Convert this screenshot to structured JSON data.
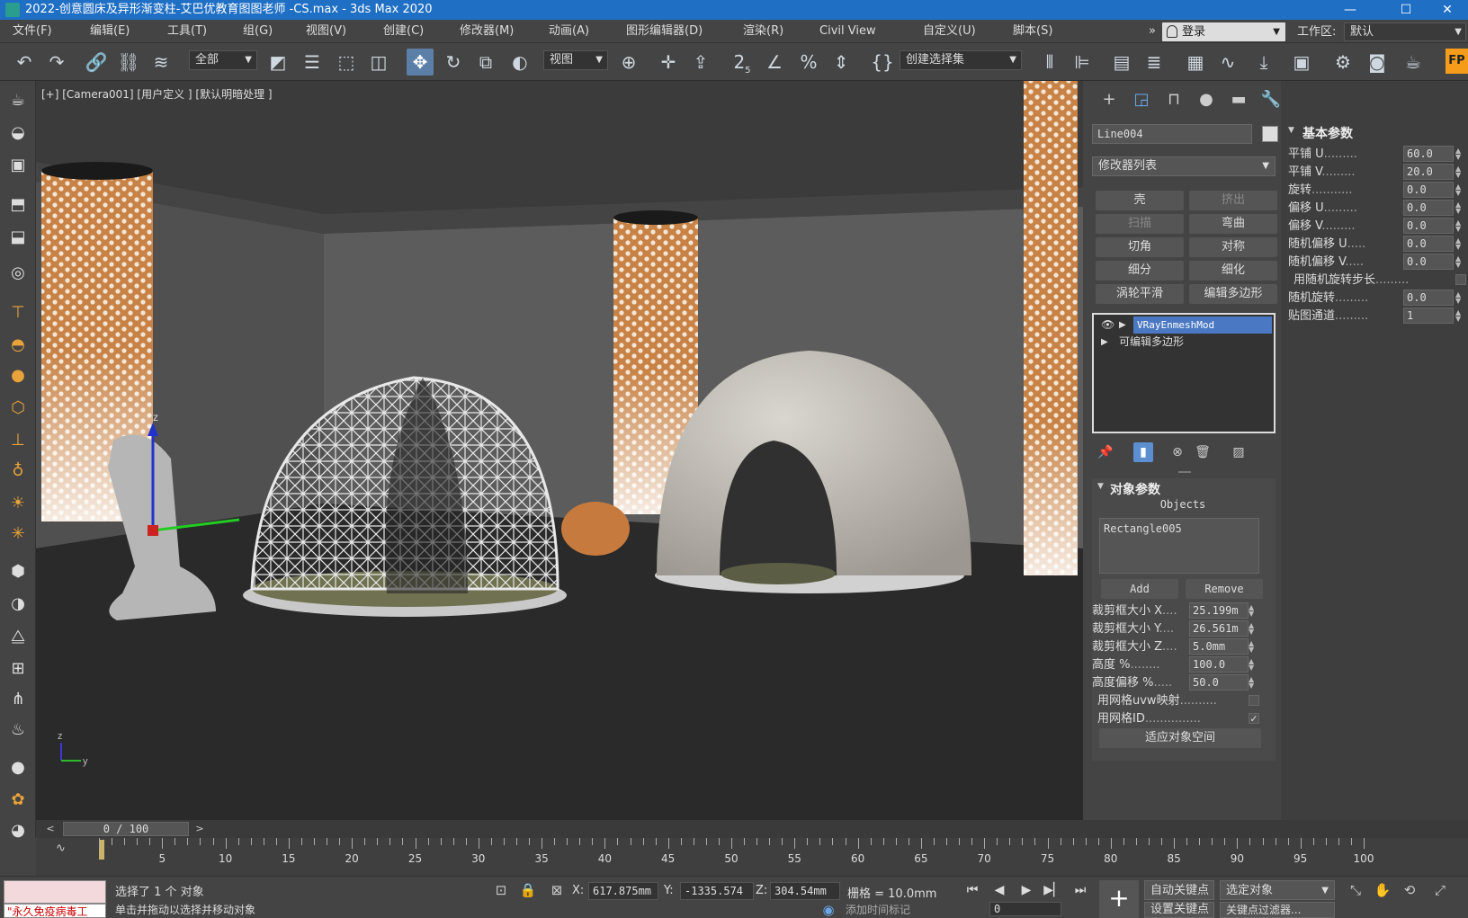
{
  "window": {
    "title": "2022-创意圆床及异形渐变柱-艾巴优教育图图老师 -CS.max - 3ds Max 2020",
    "minimize": "—",
    "maximize": "☐",
    "close": "✕"
  },
  "menu": [
    "文件(F)",
    "编辑(E)",
    "工具(T)",
    "组(G)",
    "视图(V)",
    "创建(C)",
    "修改器(M)",
    "动画(A)",
    "图形编辑器(D)",
    "渲染(R)",
    "Civil View",
    "自定义(U)",
    "脚本(S)"
  ],
  "menu_overflow": "»",
  "login_label": "登录",
  "workspace_label": "工作区:",
  "workspace_value": "默认",
  "toolbar": {
    "filter_select": "全部",
    "refcoord_select": "视图",
    "selset_select": "创建选择集",
    "snap_text": "2",
    "snap_sub": "5",
    "fp_label": "FP"
  },
  "viewport": {
    "label": "[+] [Camera001] [用户定义 ] [默认明暗处理 ]",
    "gizmo_z": "z",
    "axes_z": "z",
    "axes_y": "y"
  },
  "command_panel": {
    "object_name": "Line004",
    "modifier_list": "修改器列表",
    "buttons": [
      {
        "label": "壳",
        "disabled": false
      },
      {
        "label": "挤出",
        "disabled": true
      },
      {
        "label": "扫描",
        "disabled": true
      },
      {
        "label": "弯曲",
        "disabled": false
      },
      {
        "label": "切角",
        "disabled": false
      },
      {
        "label": "对称",
        "disabled": false
      },
      {
        "label": "细分",
        "disabled": false
      },
      {
        "label": "细化",
        "disabled": false
      },
      {
        "label": "涡轮平滑",
        "disabled": false
      },
      {
        "label": "编辑多边形",
        "disabled": false
      }
    ],
    "stack": [
      {
        "label": "VRayEnmeshMod",
        "selected": true
      },
      {
        "label": "可编辑多边形",
        "selected": false
      }
    ],
    "object_params_title": "对象参数",
    "objects_label": "Objects",
    "objects_list_item": "Rectangle005",
    "add_label": "Add",
    "remove_label": "Remove",
    "params": [
      {
        "label": "裁剪框大小 X",
        "dots": "....",
        "value": "25.199m"
      },
      {
        "label": "裁剪框大小 Y",
        "dots": "....",
        "value": "26.561m"
      },
      {
        "label": "裁剪框大小 Z",
        "dots": "....",
        "value": "5.0mm"
      },
      {
        "label": "高度 %",
        "dots": "........",
        "value": "100.0"
      },
      {
        "label": "高度偏移 %",
        "dots": ".....",
        "value": "50.0"
      }
    ],
    "checks": [
      {
        "label": "用网格uvw映射",
        "dots": "..........",
        "checked": false
      },
      {
        "label": "用网格ID",
        "dots": "...............",
        "checked": true
      }
    ],
    "fit_button": "适应对象空间"
  },
  "params_panel": {
    "title": "基本参数",
    "rows": [
      {
        "label": "平铺 U",
        "dots": ".........",
        "value": "60.0"
      },
      {
        "label": "平铺 V",
        "dots": ".........",
        "value": "20.0"
      },
      {
        "label": "旋转",
        "dots": "...........",
        "value": "0.0"
      },
      {
        "label": "偏移 U",
        "dots": ".........",
        "value": "0.0"
      },
      {
        "label": "偏移 V",
        "dots": ".........",
        "value": "0.0"
      },
      {
        "label": "随机偏移 U",
        "dots": ".....",
        "value": "0.0"
      },
      {
        "label": "随机偏移 V",
        "dots": ".....",
        "value": "0.0"
      },
      {
        "label": "用随机旋转步长",
        "dots": ".........",
        "value": null
      },
      {
        "label": "随机旋转",
        "dots": ".........",
        "value": "0.0"
      },
      {
        "label": "贴图通道",
        "dots": ".........",
        "value": "1"
      }
    ]
  },
  "timeline": {
    "frame": "0 / 100",
    "ticks": [
      "5",
      "10",
      "15",
      "20",
      "25",
      "30",
      "35",
      "40",
      "45",
      "50",
      "55",
      "60",
      "65",
      "70",
      "75",
      "80",
      "85",
      "90",
      "95",
      "100"
    ]
  },
  "status": {
    "maxscript_text": "\"永久免疫病毒工",
    "selected_text": "选择了 1 个 对象",
    "prompt_text": "单击并拖动以选择并移动对象",
    "x_label": "X:",
    "x_value": "617.875mm",
    "y_label": "Y:",
    "y_value": "-1335.574",
    "z_label": "Z:",
    "z_value": "304.54mm",
    "grid_label": "栅格 = 10.0mm",
    "autokey": "自动关键点",
    "setkey": "设置关键点",
    "selected_obj": "选定对象",
    "keyfilter": "关键点过滤器...",
    "frame_field": "0",
    "addtime": "添加时间标记"
  }
}
